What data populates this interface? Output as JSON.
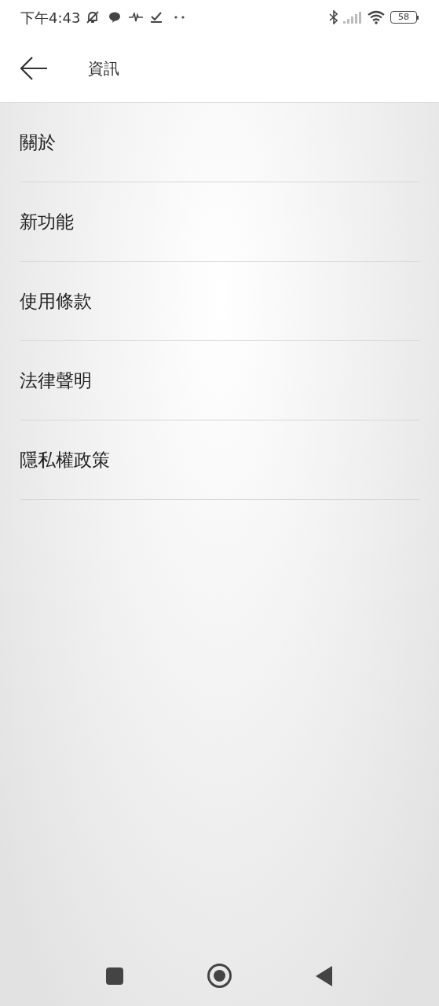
{
  "status_bar": {
    "time": "下午4:43",
    "battery": "58"
  },
  "header": {
    "title": "資訊"
  },
  "menu": [
    {
      "label": "關於"
    },
    {
      "label": "新功能"
    },
    {
      "label": "使用條款"
    },
    {
      "label": "法律聲明"
    },
    {
      "label": "隱私權政策"
    }
  ]
}
